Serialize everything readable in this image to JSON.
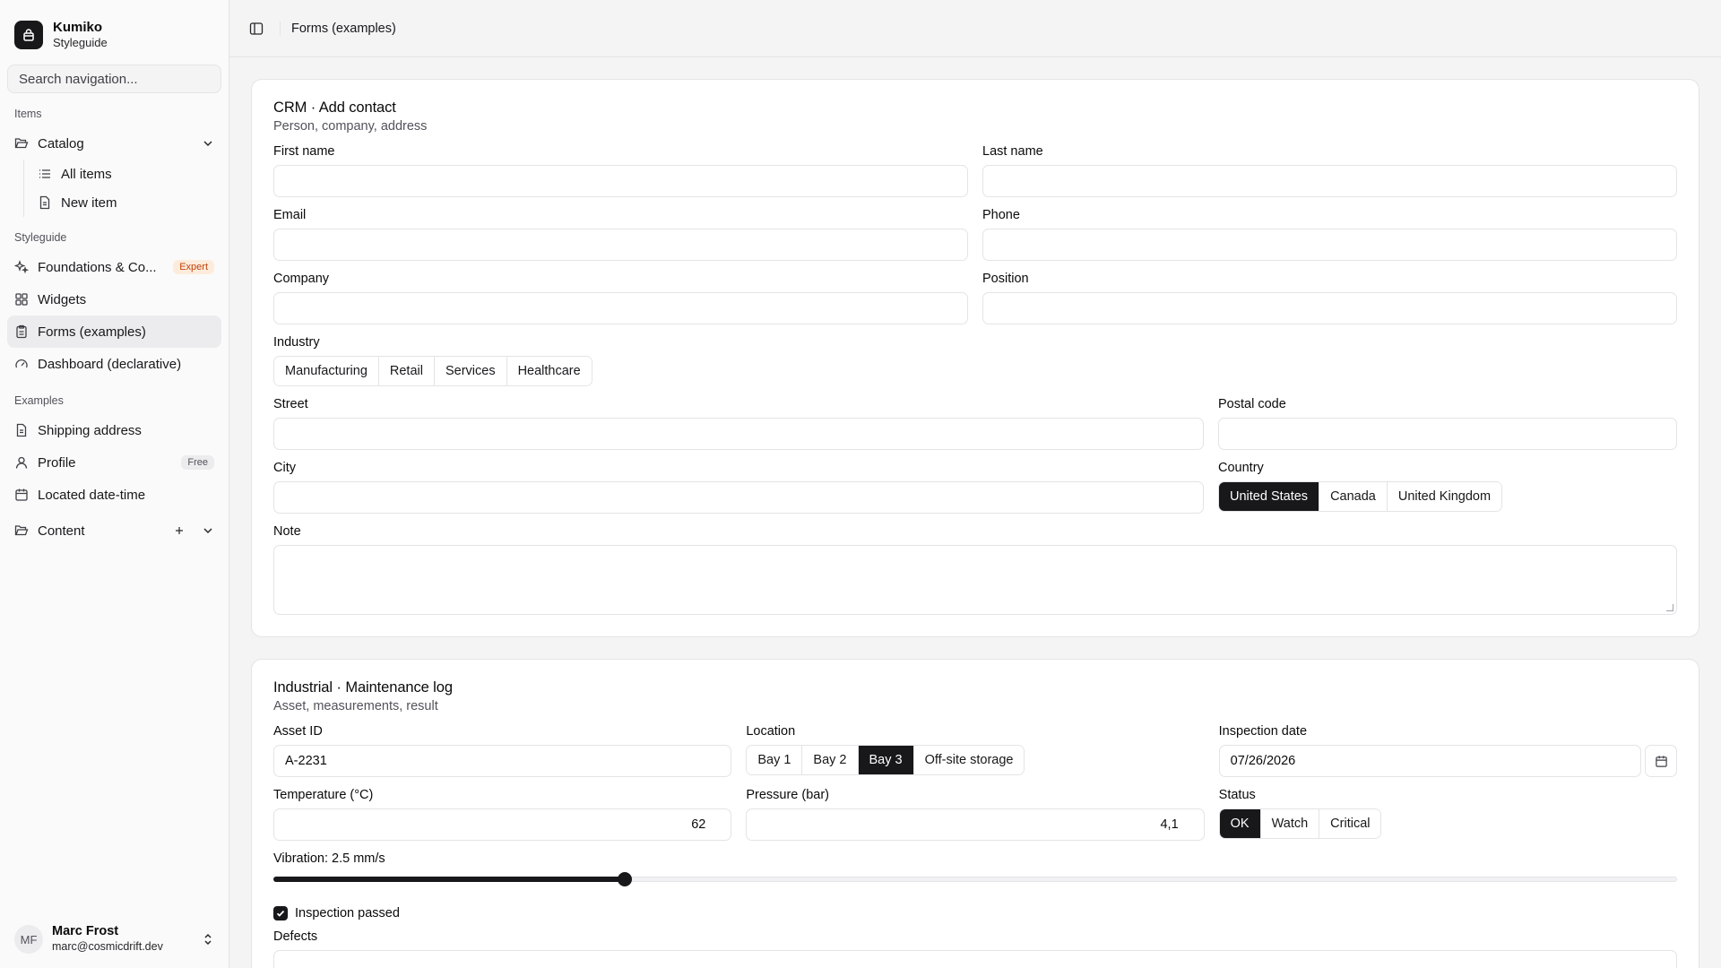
{
  "brand": {
    "name": "Kumiko",
    "subtitle": "Styleguide"
  },
  "search": {
    "placeholder": "Search navigation..."
  },
  "sidebar": {
    "groups": [
      {
        "label": "Items"
      },
      {
        "label": "Styleguide"
      },
      {
        "label": "Examples"
      }
    ],
    "catalog": {
      "label": "Catalog",
      "children": [
        {
          "label": "All items"
        },
        {
          "label": "New item"
        }
      ]
    },
    "styleguide_items": [
      {
        "label": "Foundations & Co...",
        "badge": "Expert"
      },
      {
        "label": "Widgets"
      },
      {
        "label": "Forms (examples)"
      },
      {
        "label": "Dashboard (declarative)"
      }
    ],
    "example_items": [
      {
        "label": "Shipping address"
      },
      {
        "label": "Profile",
        "badge": "Free"
      },
      {
        "label": "Located date-time"
      }
    ],
    "content": {
      "label": "Content"
    }
  },
  "user": {
    "initials": "MF",
    "name": "Marc Frost",
    "email": "marc@cosmicdrift.dev"
  },
  "topbar": {
    "breadcrumb": "Forms (examples)"
  },
  "crm": {
    "title": "CRM · Add contact",
    "subtitle": "Person, company, address",
    "first_name": {
      "label": "First name",
      "value": ""
    },
    "last_name": {
      "label": "Last name",
      "value": ""
    },
    "email": {
      "label": "Email",
      "value": ""
    },
    "phone": {
      "label": "Phone",
      "value": ""
    },
    "company": {
      "label": "Company",
      "value": ""
    },
    "position": {
      "label": "Position",
      "value": ""
    },
    "industry": {
      "label": "Industry",
      "options": [
        "Manufacturing",
        "Retail",
        "Services",
        "Healthcare"
      ],
      "selected": null
    },
    "street": {
      "label": "Street",
      "value": ""
    },
    "postal_code": {
      "label": "Postal code",
      "value": ""
    },
    "city": {
      "label": "City",
      "value": ""
    },
    "country": {
      "label": "Country",
      "options": [
        "United States",
        "Canada",
        "United Kingdom"
      ],
      "selected": "United States"
    },
    "note": {
      "label": "Note",
      "value": ""
    }
  },
  "maintenance": {
    "title": "Industrial · Maintenance log",
    "subtitle": "Asset, measurements, result",
    "asset_id": {
      "label": "Asset ID",
      "value": "A-2231"
    },
    "location": {
      "label": "Location",
      "options": [
        "Bay 1",
        "Bay 2",
        "Bay 3",
        "Off-site storage"
      ],
      "selected": "Bay 3"
    },
    "inspection_date": {
      "label": "Inspection date",
      "value": "07/26/2026"
    },
    "temperature": {
      "label": "Temperature (°C)",
      "value": "62"
    },
    "pressure": {
      "label": "Pressure (bar)",
      "value": "4,1"
    },
    "status": {
      "label": "Status",
      "options": [
        "OK",
        "Watch",
        "Critical"
      ],
      "selected": "OK"
    },
    "vibration": {
      "label": "Vibration: 2.5 mm/s",
      "level": 0.25
    },
    "inspection_passed": {
      "label": "Inspection passed",
      "checked": true
    },
    "defects": {
      "label": "Defects"
    }
  }
}
